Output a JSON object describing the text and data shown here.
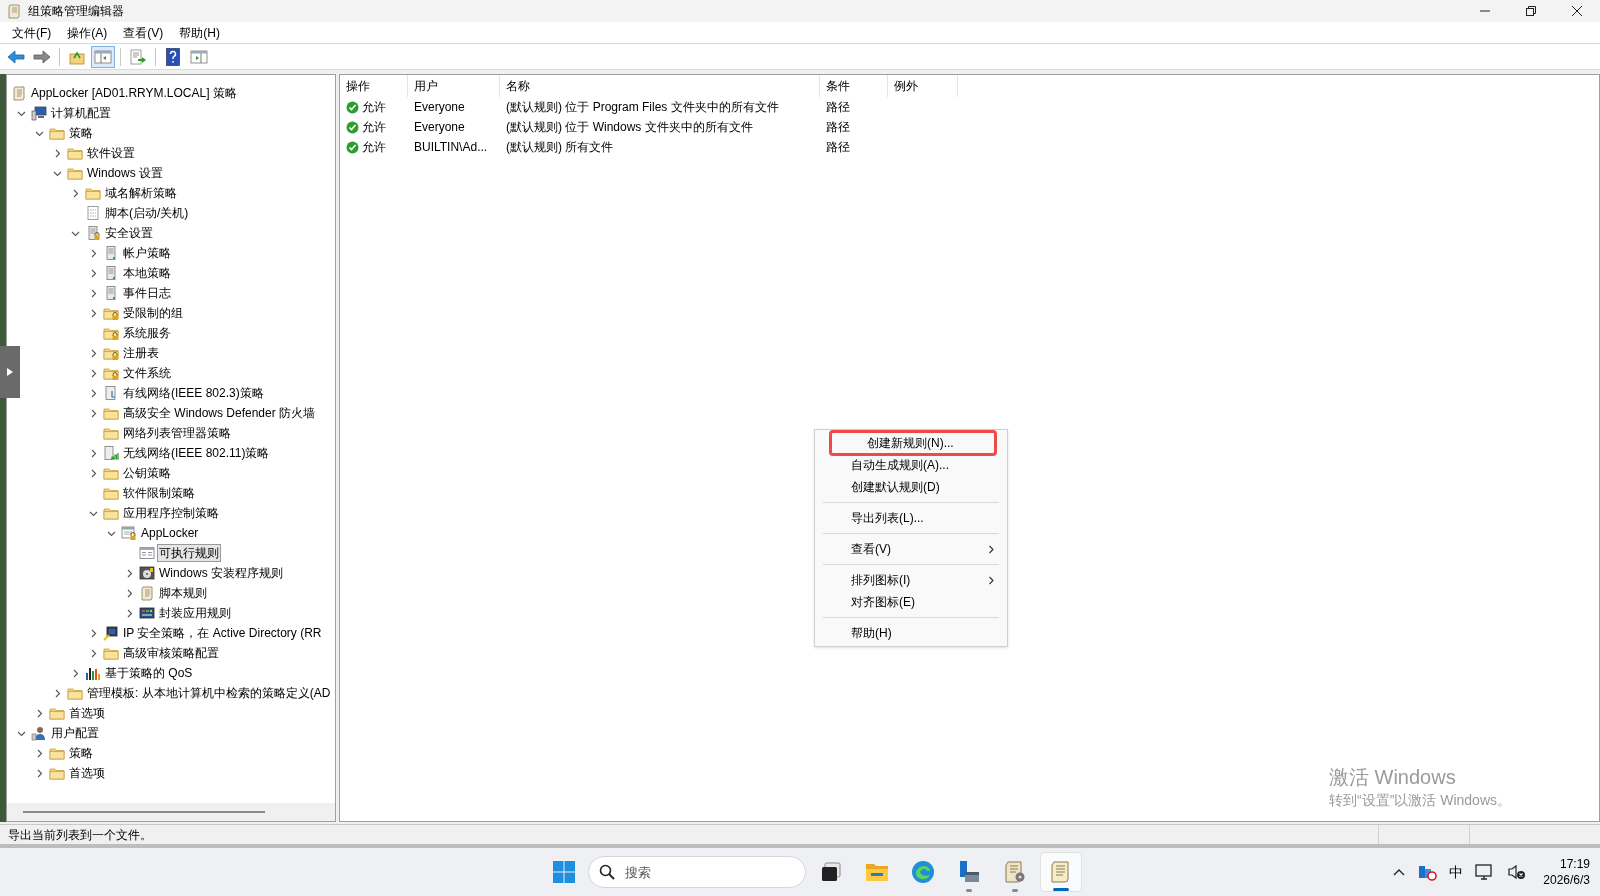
{
  "window": {
    "title": "组策略管理编辑器"
  },
  "menu_bar": [
    {
      "label": "文件(F)"
    },
    {
      "label": "操作(A)"
    },
    {
      "label": "查看(V)"
    },
    {
      "label": "帮助(H)"
    }
  ],
  "toolbar": [
    {
      "kind": "back",
      "pressed": false
    },
    {
      "kind": "forward",
      "pressed": false
    },
    {
      "kind": "separator"
    },
    {
      "kind": "up",
      "pressed": false
    },
    {
      "kind": "tree-toggle",
      "pressed": true
    },
    {
      "kind": "separator"
    },
    {
      "kind": "export",
      "pressed": false
    },
    {
      "kind": "separator"
    },
    {
      "kind": "help",
      "pressed": false
    },
    {
      "kind": "pane-toggle",
      "pressed": false
    }
  ],
  "tree": {
    "label": "AppLocker [AD01.RRYM.LOCAL] 策略",
    "kind": "scroll",
    "selected": false,
    "children": [
      {
        "label": "计算机配置",
        "kind": "computer",
        "expanded": true,
        "selected": false,
        "children": [
          {
            "label": "策略",
            "kind": "folder",
            "expanded": true,
            "selected": false,
            "children": [
              {
                "label": "软件设置",
                "kind": "folder",
                "expanded": false,
                "selected": false
              },
              {
                "label": "Windows 设置",
                "kind": "folder",
                "expanded": true,
                "selected": false,
                "children": [
                  {
                    "label": "域名解析策略",
                    "kind": "folder",
                    "expanded": false,
                    "selected": false
                  },
                  {
                    "label": "脚本(启动/关机)",
                    "kind": "script",
                    "selected": false
                  },
                  {
                    "label": "安全设置",
                    "kind": "server-lock",
                    "expanded": true,
                    "selected": false,
                    "children": [
                      {
                        "label": "帐户策略",
                        "kind": "server",
                        "expanded": false,
                        "selected": false
                      },
                      {
                        "label": "本地策略",
                        "kind": "server",
                        "expanded": false,
                        "selected": false
                      },
                      {
                        "label": "事件日志",
                        "kind": "server",
                        "expanded": false,
                        "selected": false
                      },
                      {
                        "label": "受限制的组",
                        "kind": "folder-lock",
                        "expanded": false,
                        "selected": false
                      },
                      {
                        "label": "系统服务",
                        "kind": "folder-lock",
                        "selected": false
                      },
                      {
                        "label": "注册表",
                        "kind": "folder-lock",
                        "expanded": false,
                        "selected": false
                      },
                      {
                        "label": "文件系统",
                        "kind": "folder-lock",
                        "expanded": false,
                        "selected": false
                      },
                      {
                        "label": "有线网络(IEEE 802.3)策略",
                        "kind": "network",
                        "expanded": false,
                        "selected": false
                      },
                      {
                        "label": "高级安全 Windows Defender 防火墙",
                        "kind": "folder",
                        "expanded": false,
                        "selected": false
                      },
                      {
                        "label": "网络列表管理器策略",
                        "kind": "folder",
                        "selected": false
                      },
                      {
                        "label": "无线网络(IEEE 802.11)策略",
                        "kind": "wireless",
                        "expanded": false,
                        "selected": false
                      },
                      {
                        "label": "公钥策略",
                        "kind": "folder",
                        "expanded": false,
                        "selected": false
                      },
                      {
                        "label": "软件限制策略",
                        "kind": "folder",
                        "selected": false
                      },
                      {
                        "label": "应用程序控制策略",
                        "kind": "folder",
                        "expanded": true,
                        "selected": false,
                        "children": [
                          {
                            "label": "AppLocker",
                            "kind": "applocker",
                            "expanded": true,
                            "selected": false,
                            "children": [
                              {
                                "label": "可执行规则",
                                "kind": "window",
                                "selected": true
                              },
                              {
                                "label": "Windows 安装程序规则",
                                "kind": "disc",
                                "expanded": false,
                                "selected": false
                              },
                              {
                                "label": "脚本规则",
                                "kind": "scroll",
                                "expanded": false,
                                "selected": false
                              },
                              {
                                "label": "封装应用规则",
                                "kind": "app",
                                "expanded": false,
                                "selected": false
                              }
                            ]
                          }
                        ]
                      },
                      {
                        "label": "IP 安全策略，在 Active Directory (RR",
                        "kind": "ip",
                        "expanded": false,
                        "selected": false
                      },
                      {
                        "label": "高级审核策略配置",
                        "kind": "folder",
                        "expanded": false,
                        "selected": false
                      }
                    ]
                  },
                  {
                    "label": "基于策略的 QoS",
                    "kind": "chart",
                    "expanded": false,
                    "selected": false
                  }
                ]
              },
              {
                "label": "管理模板: 从本地计算机中检索的策略定义(AD",
                "kind": "folder",
                "expanded": false,
                "selected": false
              }
            ]
          },
          {
            "label": "首选项",
            "kind": "folder",
            "expanded": false,
            "selected": false
          }
        ]
      },
      {
        "label": "用户配置",
        "kind": "user",
        "expanded": true,
        "selected": false,
        "children": [
          {
            "label": "策略",
            "kind": "folder",
            "expanded": false,
            "selected": false
          },
          {
            "label": "首选项",
            "kind": "folder",
            "expanded": false,
            "selected": false
          }
        ]
      }
    ]
  },
  "list": {
    "columns": [
      "操作",
      "用户",
      "名称",
      "条件",
      "例外"
    ],
    "rows": [
      {
        "action": "允许",
        "user": "Everyone",
        "name": "(默认规则) 位于 Program Files 文件夹中的所有文件",
        "condition": "路径"
      },
      {
        "action": "允许",
        "user": "Everyone",
        "name": "(默认规则) 位于 Windows 文件夹中的所有文件",
        "condition": "路径"
      },
      {
        "action": "允许",
        "user": "BUILTIN\\Ad...",
        "name": "(默认规则) 所有文件",
        "condition": "路径"
      }
    ]
  },
  "context_menu": {
    "items": [
      {
        "kind": "item",
        "label": "创建新规则(N)...",
        "highlighted": true,
        "submenu": false
      },
      {
        "kind": "item",
        "label": "自动生成规则(A)...",
        "highlighted": false,
        "submenu": false
      },
      {
        "kind": "item",
        "label": "创建默认规则(D)",
        "highlighted": false,
        "submenu": false
      },
      {
        "kind": "separator"
      },
      {
        "kind": "item",
        "label": "导出列表(L)...",
        "highlighted": false,
        "submenu": false
      },
      {
        "kind": "separator"
      },
      {
        "kind": "item",
        "label": "查看(V)",
        "highlighted": false,
        "submenu": true
      },
      {
        "kind": "separator"
      },
      {
        "kind": "item",
        "label": "排列图标(I)",
        "highlighted": false,
        "submenu": true
      },
      {
        "kind": "item",
        "label": "对齐图标(E)",
        "highlighted": false,
        "submenu": false
      },
      {
        "kind": "separator"
      },
      {
        "kind": "item",
        "label": "帮助(H)",
        "highlighted": false,
        "submenu": false
      }
    ]
  },
  "activation_notice": {
    "title": "激活 Windows",
    "text": "转到“设置”以激活 Windows。"
  },
  "status_bar": {
    "text": "导出当前列表到一个文件。"
  },
  "taskbar": {
    "search_placeholder": "搜索",
    "apps": [
      {
        "kind": "task-view",
        "running": false,
        "active": false
      },
      {
        "kind": "explorer",
        "running": false,
        "active": false
      },
      {
        "kind": "edge",
        "running": false,
        "active": false
      },
      {
        "kind": "server-manager",
        "running": true,
        "active": false
      },
      {
        "kind": "gpmc",
        "running": true,
        "active": false
      },
      {
        "kind": "gpedit",
        "running": true,
        "active": true
      }
    ],
    "ime": "中",
    "time": "17:19",
    "date": "2026/6/3"
  }
}
